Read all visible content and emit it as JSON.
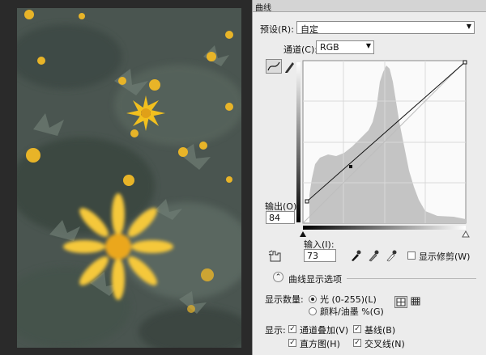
{
  "window": {
    "title": "曲线"
  },
  "preset": {
    "label": "预设(R):",
    "value": "自定"
  },
  "channel": {
    "label": "通道(C):",
    "value": "RGB"
  },
  "output": {
    "label": "输出(O):",
    "value": "84"
  },
  "input": {
    "label": "输入(I):",
    "value": "73"
  },
  "clipping": {
    "label": "显示修剪(W)",
    "checked": false
  },
  "curve_options": {
    "label": "曲线显示选项"
  },
  "show_amount": {
    "label": "显示数量:",
    "light": {
      "label": "光 (0-255)(L)",
      "selected": true
    },
    "pigment": {
      "label": "颜料/油墨 %(G)",
      "selected": false
    }
  },
  "show": {
    "label": "显示:",
    "channel_overlays": {
      "label": "通道叠加(V)",
      "checked": true
    },
    "baseline": {
      "label": "基线(B)",
      "checked": true
    },
    "histogram": {
      "label": "直方图(H)",
      "checked": true
    },
    "intersection": {
      "label": "交叉线(N)",
      "checked": true
    }
  },
  "icons": [
    "dropdown-arrow-icon",
    "curve-edit-icon",
    "pencil-icon",
    "hand-adjust-icon",
    "black-eyedropper-icon",
    "gray-eyedropper-icon",
    "white-eyedropper-icon",
    "collapse-icon",
    "grid-4-icon",
    "grid-10-icon"
  ],
  "colors": {
    "panel_bg": "#ececec",
    "curve": "#000000",
    "histogram": "#bdbdbd"
  }
}
